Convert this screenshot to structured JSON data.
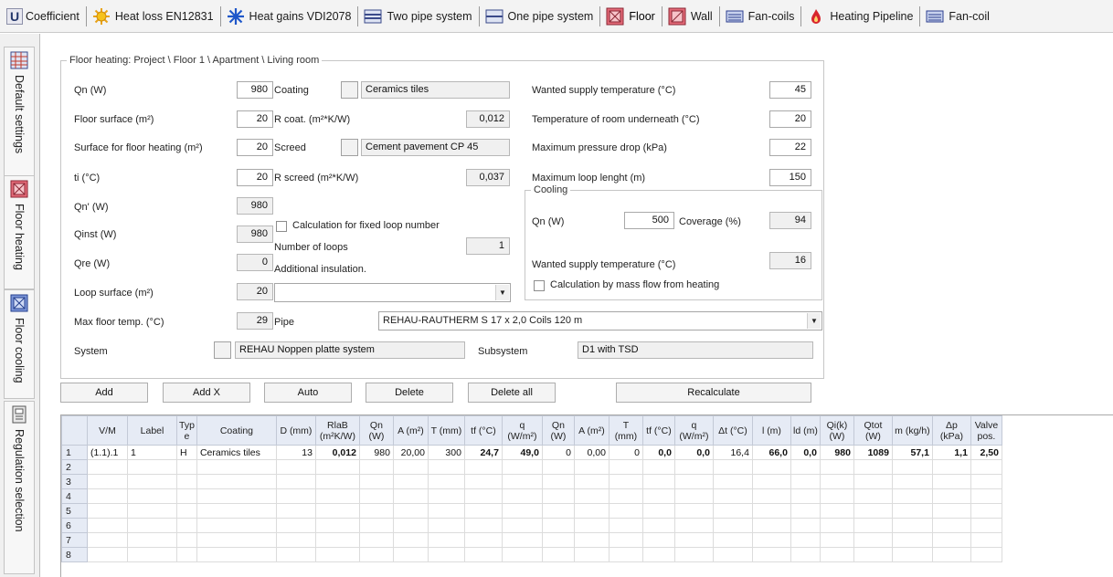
{
  "tabs": [
    {
      "label": "Coefficient",
      "icon": "u-coefficient-icon"
    },
    {
      "label": "Heat loss EN12831",
      "icon": "sun-heat-loss-icon"
    },
    {
      "label": "Heat gains VDI2078",
      "icon": "snowflake-heat-gains-icon"
    },
    {
      "label": "Two pipe system",
      "icon": "two-pipe-system-icon"
    },
    {
      "label": "One pipe system",
      "icon": "one-pipe-system-icon"
    },
    {
      "label": "Floor",
      "icon": "floor-heating-icon"
    },
    {
      "label": "Wall",
      "icon": "wall-heating-icon"
    },
    {
      "label": "Fan-coils",
      "icon": "fan-coil-icon"
    },
    {
      "label": "Heating Pipeline",
      "icon": "flame-pipeline-icon"
    },
    {
      "label": "Fan-coil",
      "icon": "fan-coil-icon"
    }
  ],
  "tab_u_glyph": "U",
  "sidebar": [
    {
      "label": "Default settings"
    },
    {
      "label": "Floor heating"
    },
    {
      "label": "Floor cooling"
    },
    {
      "label": "Regulation selection"
    }
  ],
  "form": {
    "legend": "Floor heating: Project \\ Floor 1 \\ Apartment \\ Living room",
    "qn_label": "Qn (W)",
    "qn_value": "980",
    "floor_surface_label": "Floor surface (m²)",
    "floor_surface_value": "20",
    "surface_heating_label": "Surface for floor heating (m²)",
    "surface_heating_value": "20",
    "ti_label": "ti (°C)",
    "ti_value": "20",
    "qn_prime_label": "Qn' (W)",
    "qn_prime_value": "980",
    "qinst_label": "Qinst (W)",
    "qinst_value": "980",
    "qre_label": "Qre (W)",
    "qre_value": "0",
    "loop_surface_label": "Loop surface (m²)",
    "loop_surface_value": "20",
    "max_floor_temp_label": "Max floor temp. (°C)",
    "max_floor_temp_value": "29",
    "system_label": "System",
    "system_value": "REHAU Noppen platte system",
    "coating_label": "Coating",
    "coating_value": "Ceramics tiles",
    "rcoat_label": "R coat. (m²*K/W)",
    "rcoat_value": "0,012",
    "screed_label": "Screed",
    "screed_value": "Cement pavement CP 45",
    "rscreed_label": "R screed (m²*K/W)",
    "rscreed_value": "0,037",
    "fixed_loop_label": "Calculation for fixed loop number",
    "num_loops_label": "Number of loops",
    "num_loops_value": "1",
    "add_insulation_label": "Additional insulation.",
    "add_insulation_value": "",
    "pipe_label": "Pipe",
    "pipe_value": "REHAU-RAUTHERM S 17 x 2,0 Coils 120 m",
    "subsystem_label": "Subsystem",
    "subsystem_value": "D1 with TSD",
    "wanted_supply_label": "Wanted supply temperature (°C)",
    "wanted_supply_value": "45",
    "temp_under_label": "Temperature of room underneath (°C)",
    "temp_under_value": "20",
    "max_pressure_label": "Maximum pressure drop (kPa)",
    "max_pressure_value": "22",
    "max_loop_label": "Maximum loop lenght (m)",
    "max_loop_value": "150",
    "cooling": {
      "legend": "Cooling",
      "qn_label": "Qn (W)",
      "qn_value": "500",
      "coverage_label": "Coverage (%)",
      "coverage_value": "94",
      "wanted_supply_label": "Wanted supply temperature (°C)",
      "wanted_supply_value": "16",
      "mass_flow_label": "Calculation by mass flow from heating"
    }
  },
  "buttons": {
    "add": "Add",
    "add_x": "Add X",
    "auto": "Auto",
    "delete": "Delete",
    "delete_all": "Delete all",
    "recalculate": "Recalculate"
  },
  "grid": {
    "columns": [
      "V/M",
      "Label",
      "Typ e",
      "Coating",
      "D (mm)",
      "RlaB (m²K/W)",
      "Qn (W)",
      "A (m²)",
      "T (mm)",
      "tf (°C)",
      "q (W/m²)",
      "Qn (W)",
      "A (m²)",
      "T (mm)",
      "tf (°C)",
      "q (W/m²)",
      "Δt (°C)",
      "l (m)",
      "ld (m)",
      "Qi(k) (W)",
      "Qtot (W)",
      "m (kg/h)",
      "Δp (kPa)",
      "Valve pos."
    ],
    "rows": [
      [
        "1",
        "(1.1).1",
        "1",
        "H",
        "Ceramics tiles",
        "13",
        "0,012",
        "980",
        "20,00",
        "300",
        "24,7",
        "49,0",
        "0",
        "0,00",
        "0",
        "0,0",
        "0,0",
        "16,4",
        "66,0",
        "0,0",
        "980",
        "1089",
        "57,1",
        "1,1",
        "2,50"
      ],
      [
        "2"
      ],
      [
        "3"
      ],
      [
        "4"
      ],
      [
        "5"
      ],
      [
        "6"
      ],
      [
        "7"
      ],
      [
        "8"
      ]
    ]
  }
}
